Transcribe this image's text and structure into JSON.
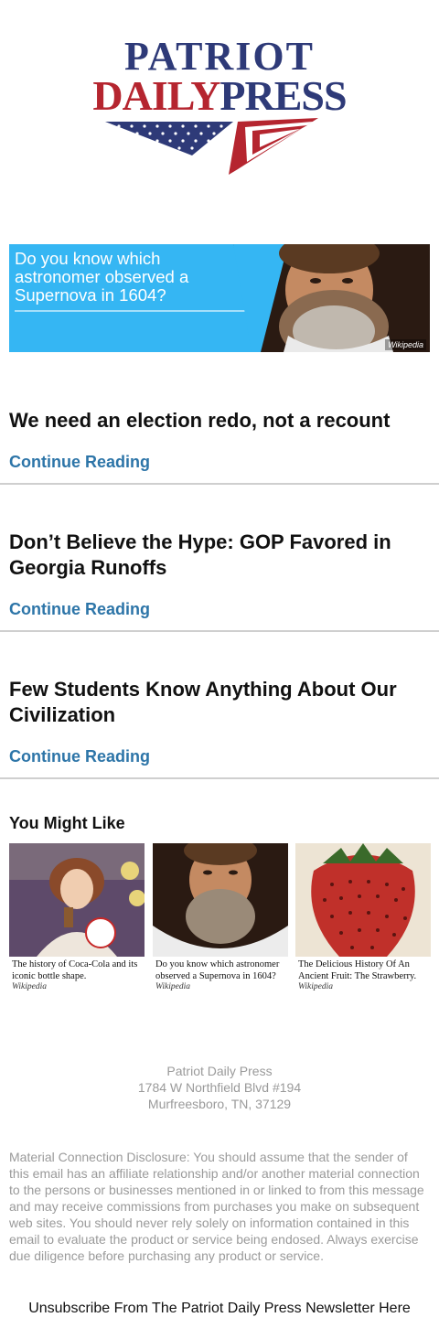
{
  "brand": {
    "line1": "PATRIOT",
    "daily": "DAILY",
    "press": "PRESS",
    "colors": {
      "navy": "#2e3a78",
      "red": "#b5252f"
    }
  },
  "banner_ad": {
    "text": "Do you know which astronomer observed a Supernova in 1604?",
    "source": "Wikipedia",
    "background": "#35b6f3"
  },
  "articles": [
    {
      "title": "We need an election redo, not a recount",
      "link": "Continue Reading"
    },
    {
      "title": "Don’t Believe the Hype: GOP Favored in Georgia Runoffs",
      "link": "Continue Reading"
    },
    {
      "title": "Few Students Know Anything About Our Civilization",
      "link": "Continue Reading"
    }
  ],
  "recommendations": {
    "heading": "You Might Like",
    "items": [
      {
        "caption": "The history of Coca-Cola and its iconic bottle shape.",
        "source": "Wikipedia",
        "image": "victorian-coca-cola-girl"
      },
      {
        "caption": "Do you know which astronomer observed a Supernova in 1604?",
        "source": "Wikipedia",
        "image": "bearded-astronomer-portrait"
      },
      {
        "caption": "The Delicious History Of An Ancient Fruit: The Strawberry.",
        "source": "Wikipedia",
        "image": "strawberry-illustration"
      }
    ]
  },
  "footer": {
    "company": "Patriot Daily Press",
    "street": "1784 W Northfield Blvd #194",
    "city": "Murfreesboro, TN, 37129",
    "disclosure": "Material Connection Disclosure: You should assume that the sender of this email has an affiliate relationship and/or another material connection to the persons or businesses mentioned in or linked to from this message and may receive commissions from purchases you make on subsequent web sites. You should never rely solely on information contained in this email to evaluate the product or service being endosed. Always exercise due diligence before purchasing any product or service.",
    "unsubscribe": "Unsubscribe From The Patriot Daily Press Newsletter Here"
  }
}
